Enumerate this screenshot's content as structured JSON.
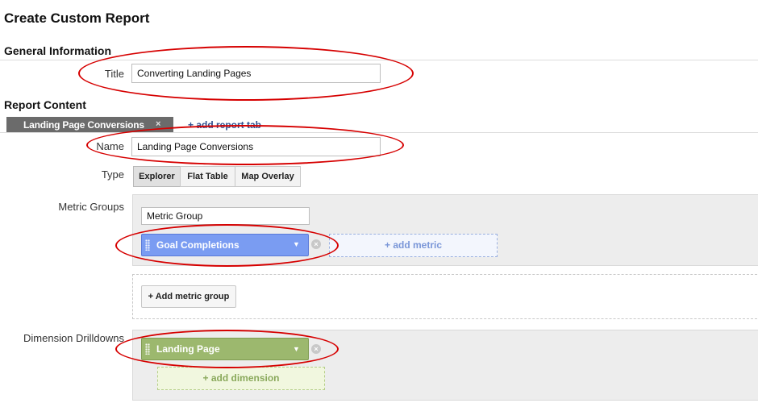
{
  "page": {
    "title": "Create Custom Report"
  },
  "general": {
    "section_title": "General Information",
    "title_label": "Title",
    "title_value": "Converting Landing Pages"
  },
  "content": {
    "section_title": "Report Content",
    "tabs": [
      {
        "label": "Landing Page Conversions",
        "close": "×"
      }
    ],
    "add_tab_label": "+ add report tab",
    "name_label": "Name",
    "name_value": "Landing Page Conversions",
    "type_label": "Type",
    "types": [
      "Explorer",
      "Flat Table",
      "Map Overlay"
    ],
    "selected_type": "Explorer"
  },
  "metrics": {
    "label": "Metric Groups",
    "group_name": "Metric Group",
    "metric": "Goal Completions",
    "add_metric_label": "+ add metric",
    "add_group_label": "+ Add metric group"
  },
  "dimensions": {
    "label": "Dimension Drilldowns",
    "dimension": "Landing Page",
    "add_dimension_label": "+ add dimension"
  },
  "colors": {
    "metric_pill": "#7a9cf2",
    "dimension_pill": "#9cb86e",
    "annotation": "#d60000",
    "active_tab": "#6b6b6b"
  }
}
